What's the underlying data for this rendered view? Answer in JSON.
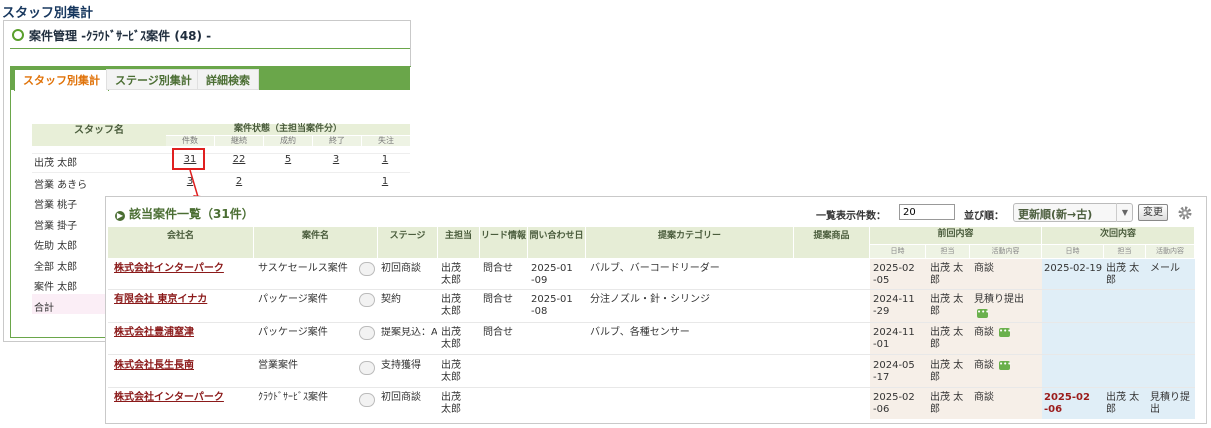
{
  "page_title": "スタッフ別集計",
  "back_panel": {
    "header": "案件管理 -ｸﾗｳﾄﾞｻｰﾋﾞｽ案件 (48) -",
    "tabs": [
      {
        "label": "スタッフ別集計",
        "active": true
      },
      {
        "label": "ステージ別集計",
        "active": false
      },
      {
        "label": "詳細検索",
        "active": false
      }
    ],
    "grid": {
      "staff_header": "スタッフ名",
      "status_header": "案件状態（主担当案件分）",
      "sub_headers": [
        "件数",
        "継続",
        "成約",
        "終了",
        "失注"
      ],
      "rows": [
        {
          "name": "出茂 太郎",
          "values": [
            "31",
            "22",
            "5",
            "3",
            "1"
          ]
        },
        {
          "name": "営業 あきら",
          "values": [
            "3",
            "2",
            "",
            "",
            "1"
          ]
        },
        {
          "name": "営業 桃子",
          "values": [
            "",
            "",
            "",
            "",
            ""
          ]
        },
        {
          "name": "営業 掛子",
          "values": [
            "",
            "",
            "",
            "",
            ""
          ]
        },
        {
          "name": "佐助 太郎",
          "values": [
            "",
            "",
            "",
            "",
            ""
          ]
        },
        {
          "name": "全部 太郎",
          "values": [
            "",
            "",
            "",
            "",
            ""
          ]
        },
        {
          "name": "案件 太郎",
          "values": [
            "",
            "",
            "",
            "",
            ""
          ]
        },
        {
          "name": "合計",
          "values": [
            "",
            "",
            "",
            "",
            ""
          ]
        }
      ]
    }
  },
  "popup": {
    "title": "該当案件一覧（31件）",
    "count_label": "一覧表示件数：",
    "count_value": "20",
    "sort_label": "並び順：",
    "sort_value": "更新順(新→古)",
    "change_button": "変更",
    "columns": [
      "会社名",
      "案件名",
      "ステージ",
      "主担当",
      "リード情報",
      "問い合わせ日",
      "提案カテゴリー",
      "提案商品",
      "前回内容",
      "次回内容"
    ],
    "prev_sub": [
      "日時",
      "担当",
      "活動内容"
    ],
    "next_sub": [
      "日時",
      "担当",
      "活動内容"
    ],
    "rows": [
      {
        "company": "株式会社インターパーク",
        "case": "サスケセールス案件",
        "stage": "初回商談",
        "owner": "出茂 太郎",
        "lead": "問合せ",
        "inquiry": "2025-01-09",
        "category": "バルブ、バーコードリーダー",
        "product": "",
        "prev_date": "2025-02-05",
        "prev_staff": "出茂 太郎",
        "prev_act": "商談",
        "next_date": "2025-02-19",
        "next_staff": "出茂 太郎",
        "next_act": "メール"
      },
      {
        "company": "有限会社 東京イナカ",
        "case": "パッケージ案件",
        "stage": "契約",
        "owner": "出茂 太郎",
        "lead": "問合せ",
        "inquiry": "2025-01-08",
        "category": "分注ノズル・針・シリンジ",
        "product": "",
        "prev_date": "2024-11-29",
        "prev_staff": "出茂 太郎",
        "prev_act": "見積り提出",
        "next_date": "",
        "next_staff": "",
        "next_act": ""
      },
      {
        "company": "株式会社豊浦窒津",
        "case": "パッケージ案件",
        "stage": "提案見込：A",
        "owner": "出茂 太郎",
        "lead": "問合せ",
        "inquiry": "",
        "category": "バルブ、各種センサー",
        "product": "",
        "prev_date": "2024-11-01",
        "prev_staff": "出茂 太郎",
        "prev_act": "商談",
        "next_date": "",
        "next_staff": "",
        "next_act": ""
      },
      {
        "company": "株式会社長生長南",
        "case": "営業案件",
        "stage": "支持獲得",
        "owner": "出茂 太郎",
        "lead": "",
        "inquiry": "",
        "category": "",
        "product": "",
        "prev_date": "2024-05-17",
        "prev_staff": "出茂 太郎",
        "prev_act": "商談",
        "next_date": "",
        "next_staff": "",
        "next_act": ""
      },
      {
        "company": "株式会社インターパーク",
        "case": "ｸﾗｳﾄﾞｻｰﾋﾞｽ案件",
        "stage": "初回商談",
        "owner": "出茂 太郎",
        "lead": "",
        "inquiry": "",
        "category": "",
        "product": "",
        "prev_date": "2025-02-06",
        "prev_staff": "出茂 太郎",
        "prev_act": "商談",
        "next_date": "2025-02-06",
        "next_staff": "出茂 太郎",
        "next_act": "見積り提出"
      }
    ]
  },
  "colors": {
    "accent_green": "#6aa64a",
    "active_tab_text": "#e0730a",
    "company_link": "#8b1a1a",
    "highlight_box": "#e02020"
  }
}
